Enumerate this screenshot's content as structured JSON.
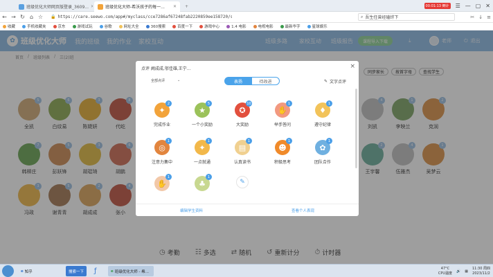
{
  "browser": {
    "tabs": [
      {
        "label": "班级优化大师网页版登录_3609...",
        "favicon_color": "#5aa0e0"
      },
      {
        "label": "班级优化大师-希沃孩子的每一...",
        "favicon_color": "#f2a33a"
      }
    ],
    "url": "https://care.seewo.com/app#/myclass/cce7286af67248fab2220859ee158720/students",
    "search_placeholder": "吾生任曾经磕绊下",
    "time_badge": "00:01:13 倒计",
    "bookmarks": [
      "收藏",
      "手机收藏夹",
      "京东",
      "游戏试玩",
      "谷歌",
      "网址大全",
      "360搜索",
      "百度一下",
      "游戏中心",
      "1.4 电影",
      "电视电影",
      "最新华字",
      "星球娱乐"
    ]
  },
  "app": {
    "logo": "班级优化大师",
    "nav": [
      "我的班级",
      "我的作业",
      "家校互动"
    ],
    "header_links": [
      "班级多路",
      "家校互动",
      "班级报告"
    ],
    "upload_label": "课程导入下载",
    "user_name": "老师",
    "logout": "退出",
    "breadcrumb": [
      "首页",
      "班级列表",
      "三(2)班"
    ],
    "right_controls": [
      "同步家长",
      "按首字母",
      "查找学生"
    ],
    "bottom_tools": [
      {
        "icon": "clock-icon",
        "label": "考勤"
      },
      {
        "icon": "multi-icon",
        "label": "多选"
      },
      {
        "icon": "random-icon",
        "label": "随机"
      },
      {
        "icon": "reset-icon",
        "label": "重新计分"
      },
      {
        "icon": "timer-icon",
        "label": "计时器"
      }
    ]
  },
  "students": [
    {
      "name": "全凯",
      "score": "5",
      "face": "#d7b588"
    },
    {
      "name": "白纹易",
      "score": "6",
      "face": "#9bb568"
    },
    {
      "name": "陈婕妍",
      "score": "3",
      "face": "#e8b84e"
    },
    {
      "name": "代屹",
      "score": "8",
      "face": "#c86a5a"
    },
    {
      "name": "刘凯",
      "score": "4",
      "face": "#c8c8c8"
    },
    {
      "name": "李映兰",
      "score": "1",
      "face": "#8fb07a"
    },
    {
      "name": "克润",
      "score": "2",
      "face": "#e0a060"
    },
    {
      "name": "韩柳庄",
      "score": "7",
      "face": "#7cb06a"
    },
    {
      "name": "彭跃锋",
      "score": "5",
      "face": "#d39a6a"
    },
    {
      "name": "胡琨琦",
      "score": "3",
      "face": "#e6c45a"
    },
    {
      "name": "胡鹏",
      "score": "6",
      "face": "#d67f6a"
    },
    {
      "name": "王宇馨",
      "score": "2",
      "face": "#7fb9a8"
    },
    {
      "name": "伍雅杰",
      "score": "4",
      "face": "#c8c8c8"
    },
    {
      "name": "吴梦云",
      "score": "1",
      "face": "#e0a060"
    },
    {
      "name": "冯政",
      "score": "3",
      "face": "#f0c060"
    },
    {
      "name": "谢青青",
      "score": "5",
      "face": "#b08a6a"
    },
    {
      "name": "胡成成",
      "score": "2",
      "face": "#e0b070"
    },
    {
      "name": "张小",
      "score": "4",
      "face": "#c86a5a"
    }
  ],
  "modal": {
    "title": "点评 阙成成,邬佳雄,王宁...",
    "filter": "全部点评",
    "tab_praise": "表扬",
    "tab_improve": "待改进",
    "text_review": "文字点评",
    "items": [
      {
        "label": "完成作业",
        "badge": "2",
        "color": "#f2a33a",
        "icon": "bulb-icon",
        "glyph": "✦"
      },
      {
        "label": "一个小奖励",
        "badge": "5",
        "color": "#9bc25a",
        "icon": "gift-icon",
        "glyph": "★"
      },
      {
        "label": "大奖励",
        "badge": "10",
        "color": "#e2503e",
        "icon": "trophy-icon",
        "glyph": "✪"
      },
      {
        "label": "举手答问",
        "badge": "1",
        "color": "#f29980",
        "icon": "hand-icon",
        "glyph": "✋"
      },
      {
        "label": "遵守纪律",
        "badge": "1",
        "color": "#f2c35a",
        "icon": "shield-icon",
        "glyph": "♦"
      },
      {
        "label": "注意力集中",
        "badge": "1",
        "color": "#e2853e",
        "icon": "target-icon",
        "glyph": "◎"
      },
      {
        "label": "一点就通",
        "badge": "1",
        "color": "#f2b84a",
        "icon": "lightbulb-icon",
        "glyph": "✦"
      },
      {
        "label": "认真读书",
        "badge": "1",
        "color": "#f0d090",
        "icon": "book-icon",
        "glyph": "▤"
      },
      {
        "label": "积极思考",
        "badge": "1",
        "color": "#f08a2a",
        "icon": "think-icon",
        "glyph": "☻"
      },
      {
        "label": "团队合作",
        "badge": "1",
        "color": "#6fb0e0",
        "icon": "team-icon",
        "glyph": "✿"
      },
      {
        "label": "",
        "badge": "1",
        "color": "#f2c8a8",
        "icon": "hand-wave-icon",
        "glyph": "✋"
      },
      {
        "label": "",
        "badge": "1",
        "color": "#c8d890",
        "icon": "book-reader-icon",
        "glyph": "♣"
      },
      {
        "label": "",
        "badge": "",
        "color": "#ffffff",
        "icon": "edit-icon",
        "glyph": "✎"
      }
    ],
    "footer": [
      "编辑学生资料",
      "查看个人表现"
    ]
  },
  "taskbar": {
    "apps": [
      "知乎",
      "搜索一下",
      "班级优化大师 - 希..."
    ],
    "temp": "47°C",
    "cpu": "CPU温度",
    "time": "11:30 周四",
    "date": "2023/11/2"
  }
}
